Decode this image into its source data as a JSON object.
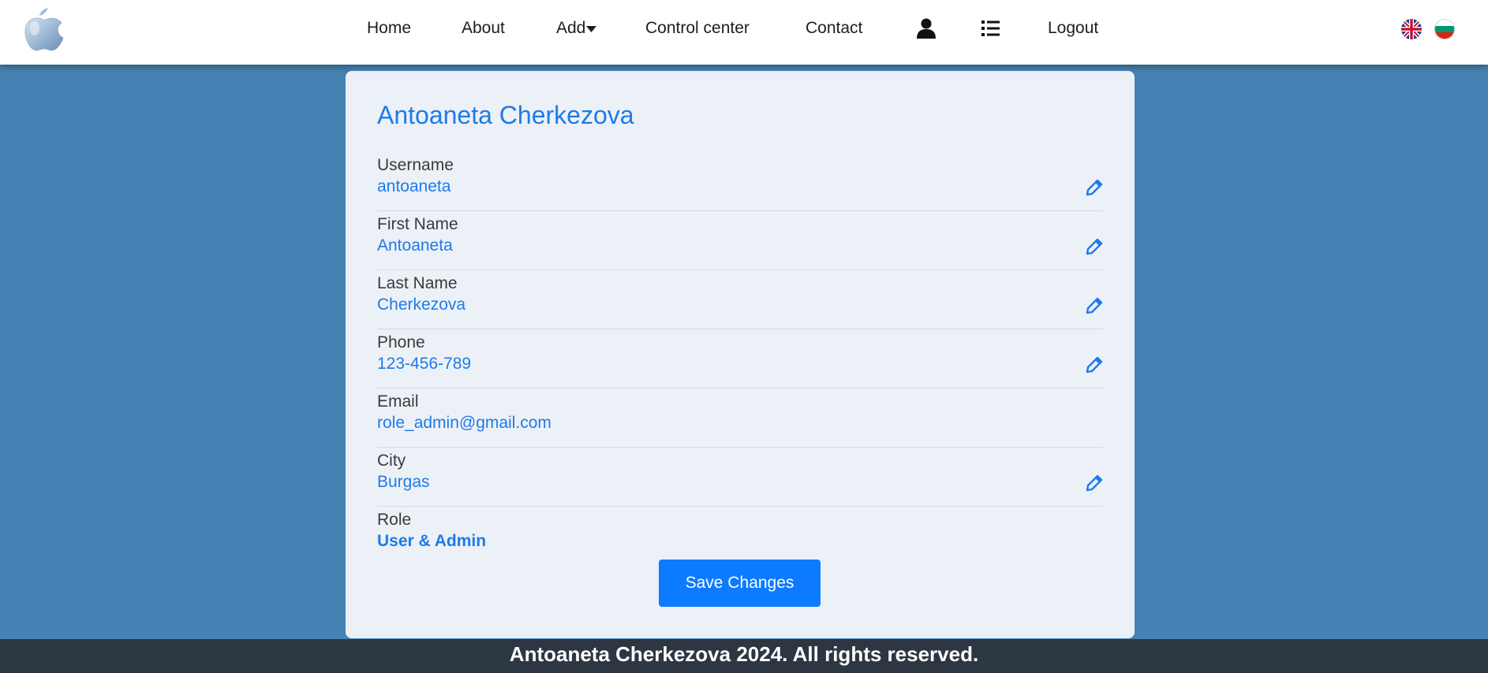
{
  "nav": {
    "logo_icon": "apple-logo-icon",
    "home": "Home",
    "about": "About",
    "add": "Add",
    "add_caret_icon": "caret-down-icon",
    "control_center": "Control center",
    "contact": "Contact",
    "profile_icon": "user-icon",
    "list_icon": "list-icon",
    "logout": "Logout",
    "flags": [
      "uk-flag-icon",
      "bulgaria-flag-icon"
    ]
  },
  "profile": {
    "title": "Antoaneta Cherkezova",
    "fields": [
      {
        "label": "Username",
        "value": "antoaneta",
        "editable": true
      },
      {
        "label": "First Name",
        "value": "Antoaneta",
        "editable": true
      },
      {
        "label": "Last Name",
        "value": "Cherkezova",
        "editable": true
      },
      {
        "label": "Phone",
        "value": "123-456-789",
        "editable": true
      },
      {
        "label": "Email",
        "value": "role_admin@gmail.com",
        "editable": false
      },
      {
        "label": "City",
        "value": "Burgas",
        "editable": true
      },
      {
        "label": "Role",
        "value": "User & Admin",
        "editable": false
      }
    ],
    "save_label": "Save Changes"
  },
  "footer": {
    "text": "Antoaneta Cherkezova 2024. All rights reserved."
  },
  "colors": {
    "page_bg": "#4682b4",
    "accent": "#1f7ae8",
    "button": "#0d7bff",
    "footer_bg": "#2d3742"
  }
}
